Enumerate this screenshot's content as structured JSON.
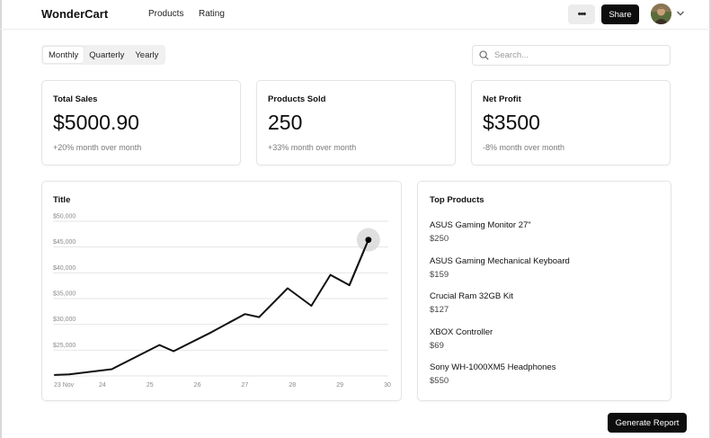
{
  "header": {
    "brand": "WonderCart",
    "nav": [
      {
        "label": "Products"
      },
      {
        "label": "Rating"
      }
    ],
    "more_label": "•••",
    "share_label": "Share"
  },
  "period_tabs": [
    {
      "label": "Monthly",
      "active": true
    },
    {
      "label": "Quarterly",
      "active": false
    },
    {
      "label": "Yearly",
      "active": false
    }
  ],
  "search": {
    "placeholder": "Search...",
    "value": ""
  },
  "stats": [
    {
      "title": "Total Sales",
      "value": "$5000.90",
      "change": "+20% month over month"
    },
    {
      "title": "Products Sold",
      "value": "250",
      "change": "+33% month over month"
    },
    {
      "title": "Net Profit",
      "value": "$3500",
      "change": "-8% month over month"
    }
  ],
  "chart_card": {
    "title": "Title"
  },
  "chart_data": {
    "type": "line",
    "title": "Title",
    "xlabel": "",
    "ylabel": "",
    "x_tick_labels": [
      "23 Nov",
      "24",
      "25",
      "26",
      "27",
      "28",
      "29",
      "30"
    ],
    "y_tick_labels": [
      "$50,000",
      "$45,000",
      "$40,000",
      "$35,000",
      "$30,000",
      "$25,000"
    ],
    "ylim": [
      20000,
      50000
    ],
    "xlim": [
      23,
      30
    ],
    "grid": true,
    "series": [
      {
        "x": [
          23.0,
          23.3,
          24.2,
          25.2,
          25.5,
          26.3,
          27.0,
          27.3,
          27.9,
          28.4,
          28.8,
          29.2,
          29.6
        ],
        "y": [
          20200,
          20300,
          21300,
          26000,
          24800,
          28500,
          32000,
          31400,
          37000,
          33600,
          39600,
          37600,
          46400
        ]
      }
    ],
    "highlight_point": {
      "x": 29.6,
      "y": 46400
    }
  },
  "top_products": {
    "title": "Top Products",
    "items": [
      {
        "name": "ASUS Gaming Monitor 27\"",
        "price": "$250"
      },
      {
        "name": "ASUS Gaming Mechanical Keyboard",
        "price": "$159"
      },
      {
        "name": "Crucial Ram 32GB Kit",
        "price": "$127"
      },
      {
        "name": "XBOX Controller",
        "price": "$69"
      },
      {
        "name": "Sony WH-1000XM5 Headphones",
        "price": "$550"
      }
    ]
  },
  "actions": {
    "generate_report_label": "Generate Report"
  },
  "colors": {
    "accent": "#0d0d0d",
    "line": "#111111",
    "grid": "#e6e6e6",
    "highlight": "#d9d9d9"
  }
}
